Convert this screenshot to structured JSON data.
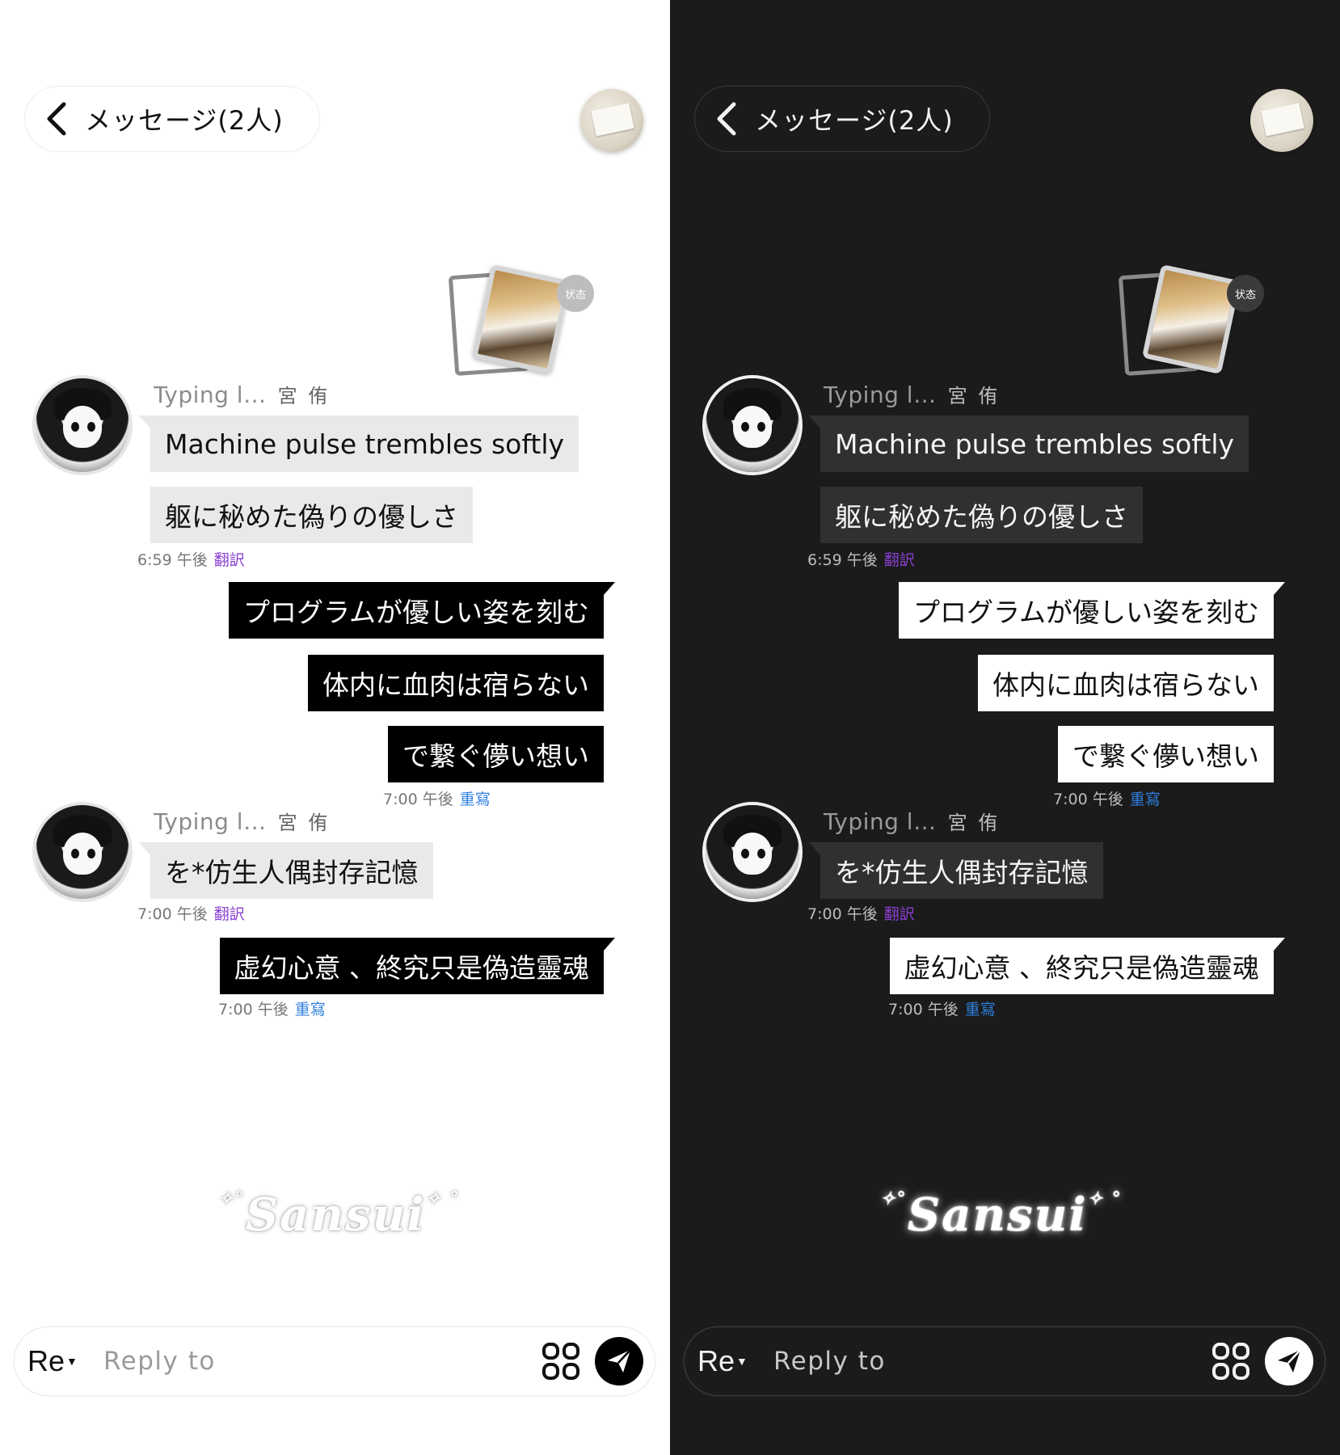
{
  "header": {
    "title": "メッセージ(2人)"
  },
  "sticker": {
    "badge": "状态"
  },
  "messages": {
    "sender1": {
      "typing": "Typing l…",
      "nick": "宮 侑"
    },
    "in1": "Machine pulse trembles softly",
    "in2": "躯に秘めた偽りの優しさ",
    "stamp1": {
      "time": "6:59 午後",
      "action": "翻訳"
    },
    "out1": "プログラムが優しい姿を刻む",
    "out2": "体内に血肉は宿らない",
    "out3": "で繋ぐ儚い想い",
    "stamp2": {
      "time": "7:00 午後",
      "action": "重寫"
    },
    "sender2": {
      "typing": "Typing l…",
      "nick": "宮 侑"
    },
    "in3": "を*仿生人偶封存記憶",
    "stamp3": {
      "time": "7:00 午後",
      "action": "翻訳"
    },
    "out4": "虚幻心意 、終究只是偽造靈魂",
    "stamp4": {
      "time": "7:00 午後",
      "action": "重寫"
    }
  },
  "watermark": "Sansui",
  "composer": {
    "re_label": "Re",
    "placeholder": "Reply to"
  },
  "colors": {
    "translate": "#8a3fd1",
    "rewrite": "#2f7fe0"
  }
}
